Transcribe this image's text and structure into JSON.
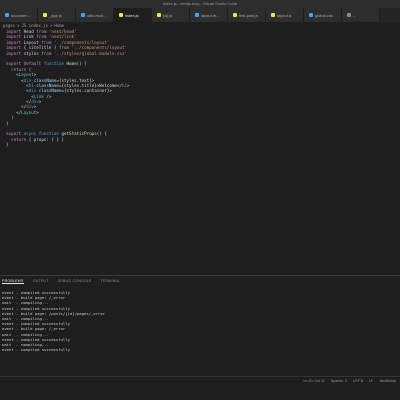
{
  "window": {
    "title": "index.js - nextjs-blog - Visual Studio Code"
  },
  "tabs": [
    {
      "label": "documentation.mdx",
      "color": "#42a5f5",
      "active": false
    },
    {
      "label": "_app.js",
      "color": "#f1e05a",
      "active": false
    },
    {
      "label": "utils.module.css",
      "color": "#42a5f5",
      "active": false
    },
    {
      "label": "index.js",
      "color": "#f1e05a",
      "active": true
    },
    {
      "label": "[id].js",
      "color": "#f1e05a",
      "active": false
    },
    {
      "label": "layout.module.css",
      "color": "#42a5f5",
      "active": false
    },
    {
      "label": "first-post.js",
      "color": "#f1e05a",
      "active": false
    },
    {
      "label": "layout.js",
      "color": "#f1e05a",
      "active": false
    },
    {
      "label": "global.css",
      "color": "#42a5f5",
      "active": false
    },
    {
      "label": "...",
      "color": "#8a8a8a",
      "active": false
    }
  ],
  "breadcrumb": [
    "pages",
    ">",
    "JS index.js",
    ">",
    "Home"
  ],
  "code": [
    [
      "kw:import",
      "txt: Head ",
      "kw:from",
      "str: 'next/head'"
    ],
    [
      "kw:import",
      "txt: Link ",
      "kw:from",
      "str: 'next/link'"
    ],
    [
      "kw:import",
      "txt: Layout ",
      "kw:from",
      "str: '../components/layout'"
    ],
    [
      "kw:import",
      "txt: { siteTitle } ",
      "kw:from",
      "str: '../components/layout'"
    ],
    [
      "kw:import",
      "txt: styles ",
      "kw:from",
      "str: '../styles/global.module.css'"
    ],
    [
      "txt:"
    ],
    [
      "kw:export default",
      "kw2: function",
      "fn: Home",
      "txt:() {"
    ],
    [
      "txt:  ",
      "kw:return",
      "txt: ("
    ],
    [
      "txt:    <",
      "comp:Layout",
      "txt:>"
    ],
    [
      "txt:      <",
      "tag:div",
      "attr: className",
      "txt:={styles.text}>"
    ],
    [
      "txt:        <",
      "tag:h1",
      "attr: className",
      "txt:={styles.title}>Welcome</",
      "tag:h1",
      "txt:>"
    ],
    [
      "txt:        <",
      "tag:div",
      "attr: className",
      "txt:={styles.container}>"
    ],
    [
      "txt:          <",
      "comp:Link",
      "txt: />"
    ],
    [
      "txt:        </",
      "tag:div",
      "txt:>"
    ],
    [
      "txt:      </",
      "tag:div",
      "txt:>"
    ],
    [
      "txt:    </",
      "comp:Layout",
      "txt:>"
    ],
    [
      "txt:  )"
    ],
    [
      "txt:}"
    ],
    [
      "txt:"
    ],
    [
      "kw:export",
      "kw2: async function",
      "fn: getStaticProps",
      "txt:() {"
    ],
    [
      "txt:  ",
      "kw:return",
      "txt: { props: { } }"
    ],
    [
      "txt:}"
    ]
  ],
  "panel": {
    "tabs": [
      "PROBLEMS",
      "OUTPUT",
      "DEBUG CONSOLE",
      "TERMINAL"
    ],
    "active_tab": "PROBLEMS"
  },
  "terminal": [
    "event - compiled successfully",
    "event - build page: /_error",
    "wait  - compiling...",
    "event - compiled successfully",
    "event - build page: /posts/[id]/pages/_error",
    "wait  - compiling...",
    "event - compiled successfully",
    "event - build page: /_error",
    "wait  - compiling...",
    "event - compiled successfully",
    "wait  - compiling...",
    "event - compiled successfully"
  ],
  "status": [
    "Ln 10, Col 21",
    "Spaces: 2",
    "UTF-8",
    "LF",
    "JavaScript"
  ]
}
